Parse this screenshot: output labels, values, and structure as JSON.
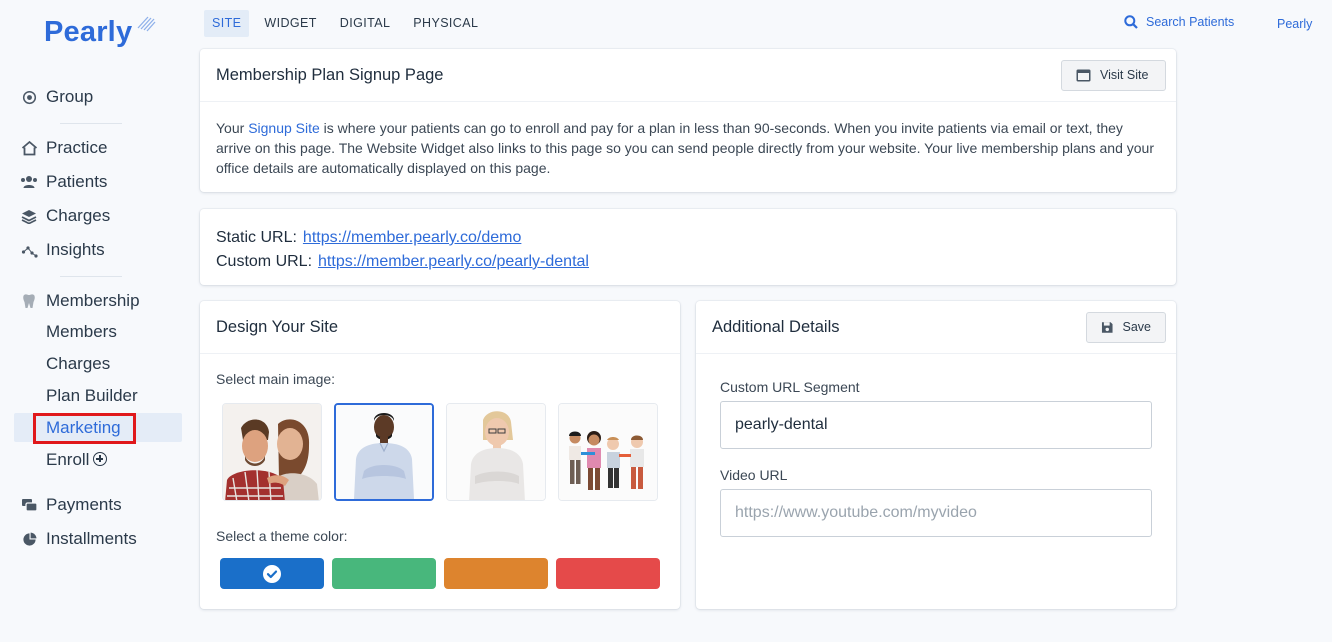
{
  "brand": {
    "name": "Pearly",
    "accent": "#2e6bd9"
  },
  "sidebar": {
    "group": {
      "label": "Group",
      "icon": "globe-icon"
    },
    "primary": [
      {
        "label": "Practice",
        "icon": "home-icon"
      },
      {
        "label": "Patients",
        "icon": "users-icon"
      },
      {
        "label": "Charges",
        "icon": "layers-icon"
      },
      {
        "label": "Insights",
        "icon": "chart-icon"
      }
    ],
    "membership": {
      "label": "Membership",
      "icon": "tooth-icon",
      "items": [
        "Members",
        "Charges",
        "Plan Builder",
        "Marketing",
        "Enroll"
      ],
      "active": "Marketing"
    },
    "secondary": [
      {
        "label": "Payments",
        "icon": "payments-icon"
      },
      {
        "label": "Installments",
        "icon": "pie-icon"
      }
    ]
  },
  "topbar": {
    "tabs": [
      "SITE",
      "WIDGET",
      "DIGITAL",
      "PHYSICAL"
    ],
    "active_tab": "SITE",
    "search_label": "Search Patients",
    "user_label": "Pearly"
  },
  "signup_card": {
    "title": "Membership Plan Signup Page",
    "visit_label": "Visit Site",
    "desc_prefix": "Your ",
    "desc_link": "Signup Site",
    "desc_rest": " is where your patients can go to enroll and pay for a plan in less than 90-seconds. When you invite patients via email or text, they arrive on this page. The Website Widget also links to this page so you can send people directly from your website. Your live membership plans and your office details are automatically displayed on this page."
  },
  "urls_card": {
    "static_label": "Static URL:",
    "static_url": "https://member.pearly.co/demo",
    "custom_label": "Custom URL:",
    "custom_url": "https://member.pearly.co/pearly-dental"
  },
  "design_card": {
    "title": "Design Your Site",
    "image_label": "Select main image:",
    "images": [
      "couple",
      "man",
      "woman",
      "kids"
    ],
    "selected_image": "man",
    "color_label": "Select a theme color:",
    "colors": [
      "#1a6fc9",
      "#48b77c",
      "#dd842e",
      "#e54a4a"
    ],
    "selected_color": "#1a6fc9"
  },
  "details_card": {
    "title": "Additional Details",
    "save_label": "Save",
    "segment_label": "Custom URL Segment",
    "segment_value": "pearly-dental",
    "video_label": "Video URL",
    "video_placeholder": "https://www.youtube.com/myvideo"
  }
}
